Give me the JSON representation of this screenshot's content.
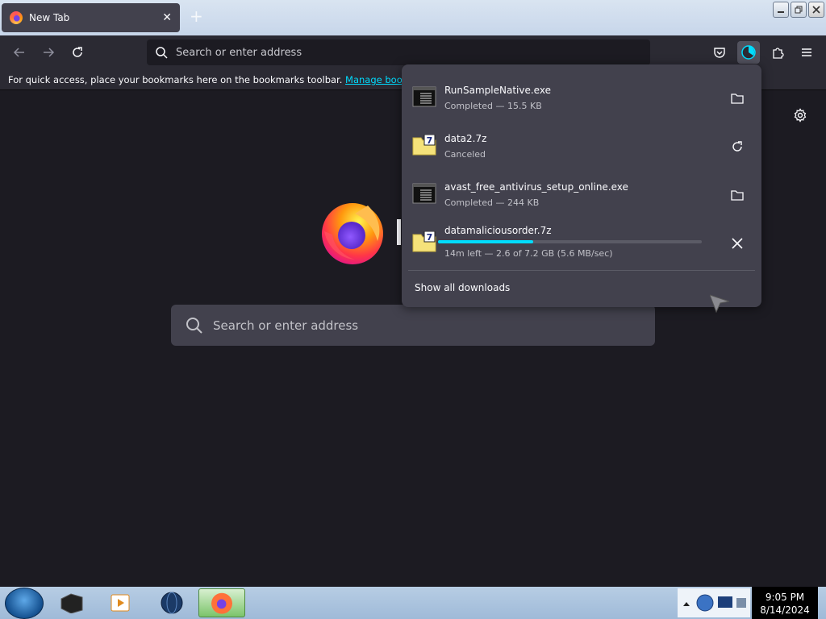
{
  "browser": {
    "tab": {
      "title": "New Tab"
    },
    "window_controls": [
      "minimize",
      "restore",
      "close"
    ]
  },
  "navbar": {
    "search_placeholder": "Search or enter address",
    "icons": [
      "back-icon",
      "forward-icon",
      "reload-icon",
      "pocket-icon",
      "downloads-icon",
      "extensions-icon",
      "menu-icon"
    ]
  },
  "bookmarks_bar": {
    "message": "For quick access, place your bookmarks here on the bookmarks toolbar.",
    "link": "Manage bookmarks…"
  },
  "newtab": {
    "search_placeholder": "Search or enter address"
  },
  "downloads": {
    "items": [
      {
        "name": "RunSampleNative.exe",
        "status": "Completed — 15.5 KB",
        "file_icon": "executable-icon",
        "action": "folder-icon"
      },
      {
        "name": "data2.7z",
        "status": "Canceled",
        "file_icon": "7z-archive-icon",
        "action": "retry-icon"
      },
      {
        "name": "avast_free_antivirus_setup_online.exe",
        "status": "Completed — 244 KB",
        "file_icon": "executable-icon",
        "action": "folder-icon"
      },
      {
        "name": "datamaliciousorder.7z",
        "status": "14m left — 2.6 of 7.2 GB (5.6 MB/sec)",
        "file_icon": "7z-archive-icon",
        "action": "cancel-icon",
        "progress": 0.36
      }
    ],
    "show_all": "Show all downloads"
  },
  "taskbar": {
    "time": "9:05 PM",
    "date": "8/14/2024"
  },
  "colors": {
    "accent": "#00ddff",
    "panel": "#42414d",
    "background": "#1c1b22",
    "toolbar": "#2b2a33"
  }
}
